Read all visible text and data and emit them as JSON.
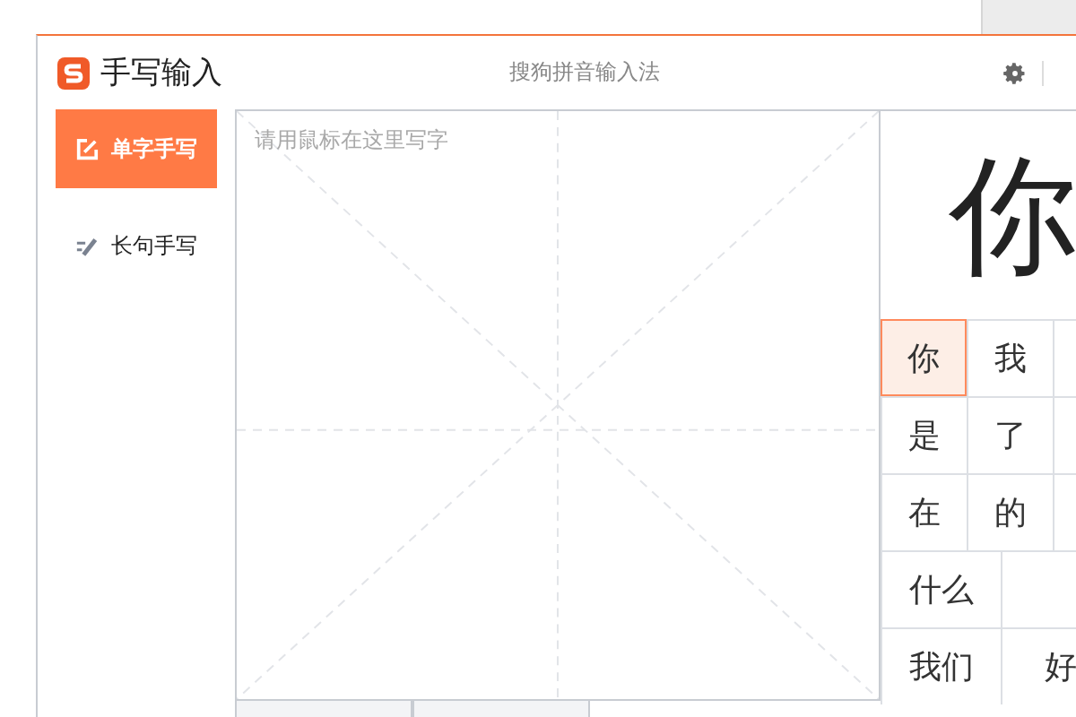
{
  "window": {
    "title": "手写输入",
    "subtitle": "搜狗拼音输入法"
  },
  "modes": [
    {
      "label": "单字手写",
      "selected": true,
      "kind": "single"
    },
    {
      "label": "长句手写",
      "selected": false,
      "kind": "sentence"
    }
  ],
  "canvas": {
    "placeholder": "请用鼠标在这里写字"
  },
  "preview": {
    "character": "你"
  },
  "candidate_rows": [
    {
      "kind": "single",
      "cells": [
        {
          "text": "你",
          "selected": true
        },
        {
          "text": "我",
          "selected": false
        }
      ]
    },
    {
      "kind": "single",
      "cells": [
        {
          "text": "是",
          "selected": false
        },
        {
          "text": "了",
          "selected": false
        }
      ]
    },
    {
      "kind": "single",
      "cells": [
        {
          "text": "在",
          "selected": false
        },
        {
          "text": "的",
          "selected": false
        }
      ]
    },
    {
      "kind": "double",
      "cells": [
        {
          "text": "什么",
          "selected": false
        }
      ]
    },
    {
      "kind": "double",
      "cells": [
        {
          "text": "我们",
          "selected": false
        },
        {
          "text": "好",
          "selected": false
        }
      ]
    }
  ]
}
